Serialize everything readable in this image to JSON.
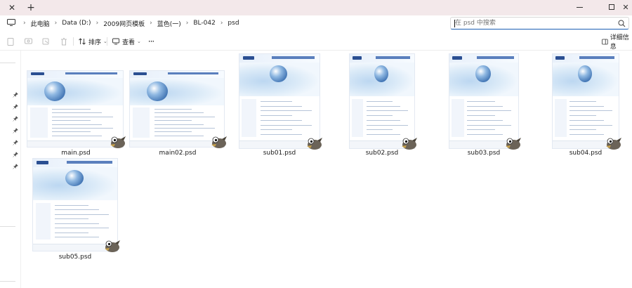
{
  "tabbar": {
    "close_glyph": "✕",
    "add_glyph": "+",
    "window": {
      "minimize": "minimize-icon",
      "maximize": "maximize-icon",
      "close_glyph": "✕"
    }
  },
  "address": {
    "breadcrumbs": [
      "此电脑",
      "Data (D:)",
      "2009网页模板",
      "蓝色(一)",
      "BL-042",
      "psd"
    ],
    "separator": "›",
    "search_placeholder": "在 psd 中搜索"
  },
  "commandbar": {
    "sort_label": "排序",
    "view_label": "查看",
    "more_glyph": "···",
    "details_label": "详细信息"
  },
  "files": [
    {
      "name": "main.psd",
      "type": "psd"
    },
    {
      "name": "main02.psd",
      "type": "psd"
    },
    {
      "name": "sub01.psd",
      "type": "psd"
    },
    {
      "name": "sub02.psd",
      "type": "psd"
    },
    {
      "name": "sub03.psd",
      "type": "psd"
    },
    {
      "name": "sub04.psd",
      "type": "psd"
    },
    {
      "name": "sub05.psd",
      "type": "psd"
    }
  ],
  "colors": {
    "tabbar_bg": "#f3e8ea",
    "accent": "#1a5fb4",
    "template_navy": "#2b4f92"
  },
  "icons": [
    "close-icon",
    "add-tab-icon",
    "computer-icon",
    "chevron-right-icon",
    "search-icon",
    "new-icon",
    "cut-icon",
    "copy-icon",
    "paste-icon",
    "delete-icon",
    "sort-icon",
    "view-icon",
    "more-icon",
    "details-pane-icon",
    "pin-icon",
    "gimp-file-icon"
  ]
}
